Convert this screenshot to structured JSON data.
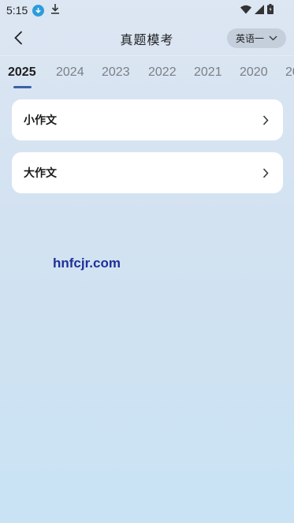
{
  "status_bar": {
    "time": "5:15",
    "icons": [
      "download-badge-icon",
      "download-arrow-icon",
      "wifi-icon",
      "signal-icon",
      "battery-icon"
    ]
  },
  "nav": {
    "title": "真题模考",
    "back_icon": "chevron-left-icon",
    "language_label": "英语一",
    "language_icon": "chevron-down-icon"
  },
  "tabs": {
    "items": [
      "2025",
      "2024",
      "2023",
      "2022",
      "2021",
      "2020",
      "20"
    ],
    "active_index": 0
  },
  "cards": [
    {
      "label": "小作文",
      "icon": "chevron-right-icon"
    },
    {
      "label": "大作文",
      "icon": "chevron-right-icon"
    }
  ],
  "watermark": "hnfcjr.com",
  "colors": {
    "accent": "#3b62a8",
    "card_bg": "#ffffff",
    "lang_pill_bg": "#c5cfdc",
    "watermark": "#1f2f9a"
  }
}
